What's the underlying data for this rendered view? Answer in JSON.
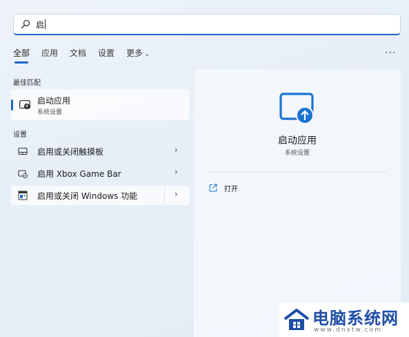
{
  "search": {
    "query": "启"
  },
  "tabs": [
    {
      "label": "全部"
    },
    {
      "label": "应用"
    },
    {
      "label": "文档"
    },
    {
      "label": "设置"
    },
    {
      "label": "更多"
    }
  ],
  "best_match": {
    "section_label": "最佳匹配",
    "title": "启动应用",
    "subtitle": "系统设置"
  },
  "settings": {
    "section_label": "设置",
    "items": [
      {
        "label": "启用或关闭触摸板"
      },
      {
        "label": "启用 Xbox Game Bar"
      },
      {
        "label": "启用或关闭 Windows 功能"
      }
    ]
  },
  "detail": {
    "title": "启动应用",
    "subtitle": "系统设置",
    "open_label": "打开"
  },
  "watermark": {
    "text": "电脑系统网",
    "url": "www.dnxtw.com"
  },
  "colors": {
    "accent": "#1f66c9",
    "icon_blue": "#1a73d0",
    "watermark_blue": "#1e4ea6"
  },
  "icons": {
    "search": "search-icon",
    "more": "more-dots-icon",
    "startup_app": "startup-app-icon",
    "touchpad": "touchpad-icon",
    "xbox": "game-bar-icon",
    "windows_features": "windows-features-icon",
    "open": "open-external-icon"
  }
}
